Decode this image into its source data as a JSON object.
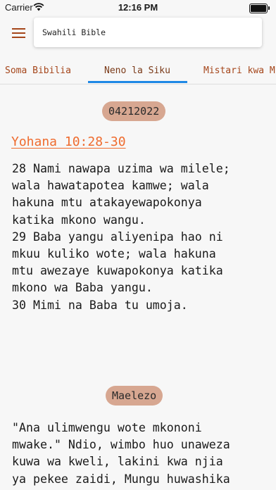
{
  "status_bar": {
    "carrier": "Carrier",
    "time": "12:16 PM"
  },
  "header": {
    "title": "Swahili Bible",
    "menu_icon": "hamburger-menu-icon"
  },
  "tabs": [
    {
      "label": "Soma Bibilia",
      "selected": false
    },
    {
      "label": "Neno la Siku",
      "selected": true
    },
    {
      "label": "Mistari kwa M",
      "selected": false
    }
  ],
  "verse_of_day": {
    "date": "04212022",
    "reference": "Yohana 10:28-30",
    "lines": [
      "28 Nami nawapa uzima wa milele;",
      "wala hawatapotea kamwe; wala",
      "hakuna mtu atakayewapokonya",
      "katika mkono wangu.",
      "29 Baba yangu aliyenipa hao ni",
      "mkuu kuliko wote; wala hakuna",
      "mtu awezaye kuwapokonya katika",
      "mkono wa Baba yangu.",
      "30 Mimi na Baba tu umoja."
    ]
  },
  "commentary": {
    "label": "Maelezo",
    "lines": [
      "\"Ana ulimwengu wote mkononi",
      "mwake.\" Ndio, wimbo huo unaweza",
      "kuwa wa kweli, lakini kwa njia",
      "ya pekee zaidi, Mungu huwashika"
    ]
  },
  "colors": {
    "accent": "#a5461b",
    "link": "#ef6b2e",
    "chip": "#d7a791",
    "tab_indicator": "#1e88e5"
  }
}
